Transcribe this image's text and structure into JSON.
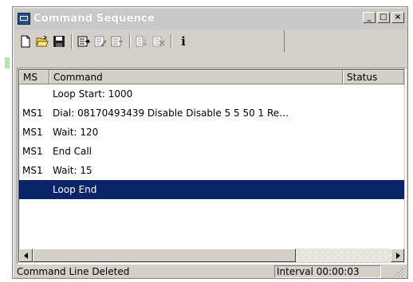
{
  "window": {
    "title": "Command Sequence",
    "controls": {
      "minimize": "_",
      "maximize": "□",
      "close": "×"
    }
  },
  "toolbar": {
    "buttons": [
      {
        "name": "new",
        "icon": "new-document-icon"
      },
      {
        "name": "open",
        "icon": "open-folder-icon"
      },
      {
        "name": "save",
        "icon": "save-disk-icon"
      },
      {
        "name": "add-command",
        "icon": "add-command-icon"
      },
      {
        "name": "edit-command",
        "icon": "edit-command-icon"
      },
      {
        "name": "insert-command",
        "icon": "insert-command-icon"
      },
      {
        "name": "move-down",
        "icon": "move-down-icon"
      },
      {
        "name": "delete-command",
        "icon": "delete-command-icon"
      },
      {
        "name": "info",
        "icon": "info-icon",
        "label": "i"
      }
    ]
  },
  "list": {
    "columns": {
      "ms": "MS",
      "command": "Command",
      "status": "Status"
    },
    "rows": [
      {
        "ms": "",
        "command": "Loop Start: 1000",
        "status": "",
        "selected": false
      },
      {
        "ms": "MS1",
        "command": "Dial: 08170493439 Disable Disable 5 5 50 1 Re…",
        "status": "",
        "selected": false
      },
      {
        "ms": "MS1",
        "command": "Wait: 120",
        "status": "",
        "selected": false
      },
      {
        "ms": "MS1",
        "command": "End Call",
        "status": "",
        "selected": false
      },
      {
        "ms": "MS1",
        "command": "Wait: 15",
        "status": "",
        "selected": false
      },
      {
        "ms": "",
        "command": "Loop End",
        "status": "",
        "selected": true
      }
    ]
  },
  "statusbar": {
    "message": "Command Line Deleted",
    "interval": "Interval 00:00:03"
  },
  "colors": {
    "selection": "#0a246a",
    "window_face": "#d4d0c8",
    "title_inactive": "#c9c9c9"
  }
}
